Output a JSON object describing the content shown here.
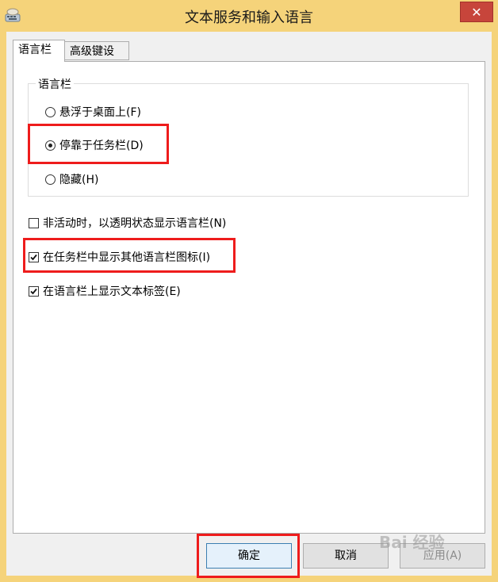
{
  "window": {
    "title": "文本服务和输入语言",
    "close_label": "✕",
    "app_icon": "keyboard-icon",
    "accent_titlebar": "#f5d37a",
    "close_color": "#c7453b"
  },
  "tabs": [
    {
      "label": "语言栏",
      "active": true
    },
    {
      "label": "高级键设置",
      "active": false
    }
  ],
  "language_bar_group": {
    "legend": "语言栏",
    "options": [
      {
        "label": "悬浮于桌面上(F)",
        "selected": false
      },
      {
        "label": "停靠于任务栏(D)",
        "selected": true
      },
      {
        "label": "隐藏(H)",
        "selected": false
      }
    ]
  },
  "checkboxes": [
    {
      "label": "非活动时，以透明状态显示语言栏(N)",
      "checked": false
    },
    {
      "label": "在任务栏中显示其他语言栏图标(I)",
      "checked": true
    },
    {
      "label": "在语言栏上显示文本标签(E)",
      "checked": true
    }
  ],
  "buttons": {
    "ok": "确定",
    "cancel": "取消",
    "apply": "应用(A)"
  },
  "highlight_color": "#ee1c1c",
  "watermark": "Bai 经验"
}
